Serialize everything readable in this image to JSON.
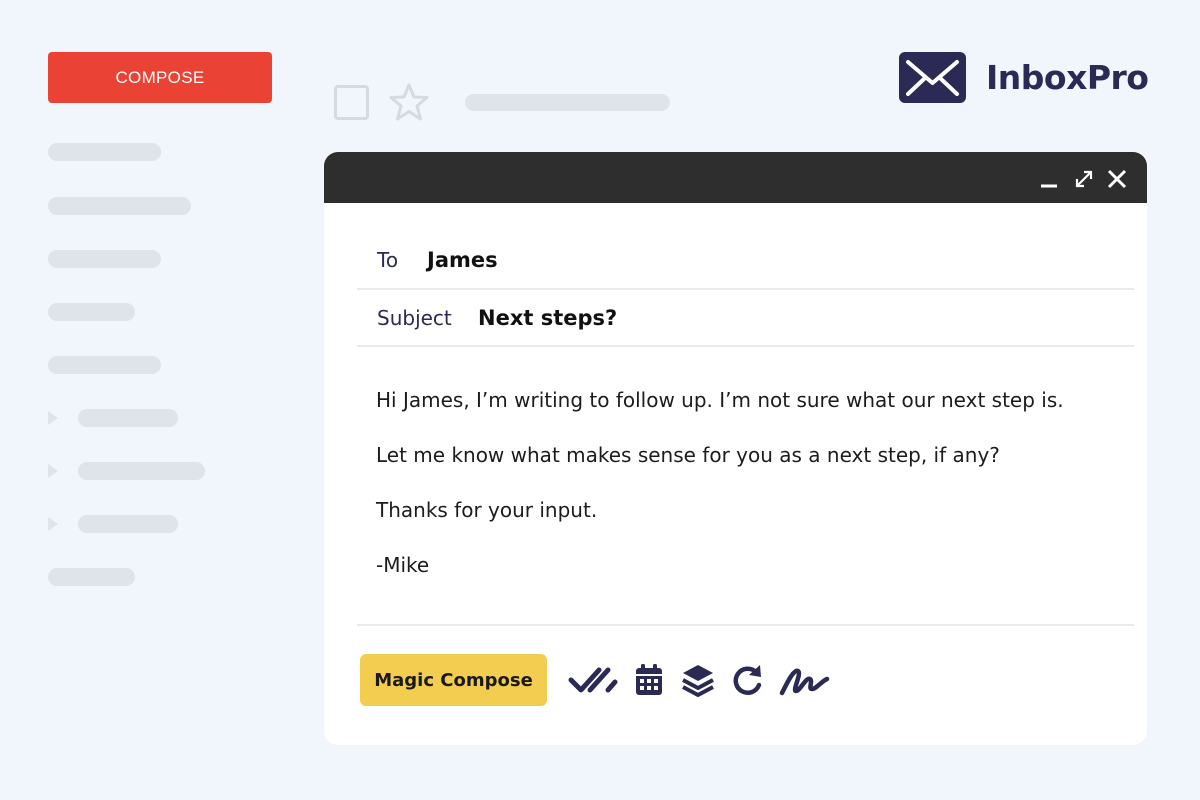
{
  "sidebar": {
    "compose_label": "COMPOSE"
  },
  "brand": {
    "name": "InboxPro",
    "color": "#2b2a54"
  },
  "colors": {
    "compose": "#ea4335",
    "magic": "#f3cd4f",
    "titlebar": "#2e2e2e"
  },
  "email": {
    "to_label": "To",
    "to_value": "James",
    "subject_label": "Subject",
    "subject_value": "Next steps?",
    "body": [
      "Hi James, I’m writing to follow up. I’m not sure what our next step is.",
      "Let me know what makes sense for you as a next step, if any?",
      "Thanks for your input.",
      "-Mike"
    ]
  },
  "window_controls": [
    "minimize-icon",
    "expand-icon",
    "close-icon"
  ],
  "toolbar": {
    "magic_label": "Magic Compose",
    "tools": [
      "double-check-icon",
      "calendar-icon",
      "layers-icon",
      "redo-icon",
      "signature-icon"
    ]
  }
}
